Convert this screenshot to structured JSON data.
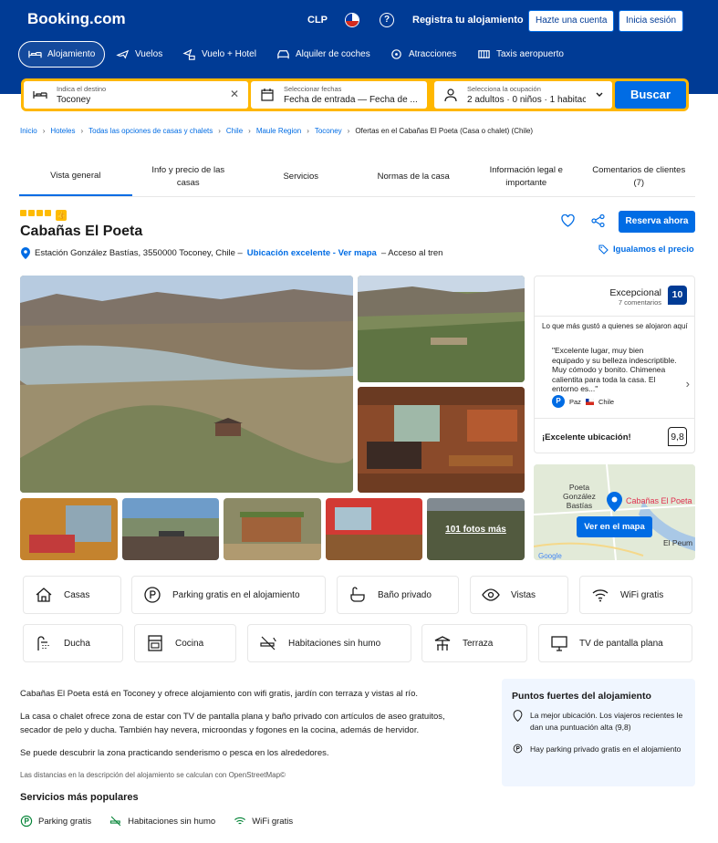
{
  "header": {
    "logo": "Booking.com",
    "currency": "CLP",
    "help": "?",
    "register": "Registra tu alojamiento",
    "signup": "Hazte una cuenta",
    "signin": "Inicia sesión"
  },
  "nav": [
    {
      "label": "Alojamiento",
      "icon": "bed-icon"
    },
    {
      "label": "Vuelos",
      "icon": "plane-icon"
    },
    {
      "label": "Vuelo + Hotel",
      "icon": "plane-hotel-icon"
    },
    {
      "label": "Alquiler de coches",
      "icon": "car-icon"
    },
    {
      "label": "Atracciones",
      "icon": "attractions-icon"
    },
    {
      "label": "Taxis aeropuerto",
      "icon": "taxi-icon"
    }
  ],
  "search": {
    "dest_label": "Indica el destino",
    "dest_value": "Toconey",
    "dates_label": "Seleccionar fechas",
    "dates_value": "Fecha de entrada — Fecha de ...",
    "occ_label": "Selecciona la ocupación",
    "occ_value": "2 adultos · 0 niños · 1 habitac",
    "button": "Buscar"
  },
  "breadcrumb": [
    "Inicio",
    "Hoteles",
    "Todas las opciones de casas y chalets",
    "Chile",
    "Maule Region",
    "Toconey",
    "Ofertas en el Cabañas El Poeta (Casa o chalet) (Chile)"
  ],
  "tabs": [
    "Vista general",
    "Info y precio de las casas",
    "Servicios",
    "Normas de la casa",
    "Información legal e importante",
    "Comentarios de clientes (7)"
  ],
  "property": {
    "name": "Cabañas El Poeta",
    "address": "Estación González Bastías, 3550000 Toconey, Chile –",
    "location_link": "Ubicación excelente - Ver mapa",
    "address_suffix": "– Acceso al tren",
    "reserve": "Reserva ahora",
    "price_match": "Igualamos el precio"
  },
  "gallery": {
    "more": "101 fotos más"
  },
  "review": {
    "label": "Excepcional",
    "count": "7 comentarios",
    "score": "10",
    "liked": "Lo que más gustó a quienes se alojaron aquí",
    "quote": "\"Excelente lugar, muy bien equipado y su belleza indescriptible. Muy cómodo y bonito. Chimenea calientita para toda la casa. El entorno es...\"",
    "author": "Paz",
    "author_initial": "P",
    "country": "Chile",
    "location_label": "¡Excelente ubicación!",
    "location_score": "9,8"
  },
  "map": {
    "place1": "Poeta",
    "place2": "González",
    "place3": "Bastías",
    "pin_label": "Cabañas El Poeta",
    "button": "Ver en el mapa",
    "google": "Google",
    "peum": "El Peum"
  },
  "facilities_row1": [
    {
      "label": "Casas",
      "icon": "house-icon"
    },
    {
      "label": "Parking gratis en el alojamiento",
      "icon": "parking-icon"
    },
    {
      "label": "Baño privado",
      "icon": "bath-icon"
    },
    {
      "label": "Vistas",
      "icon": "eye-icon"
    },
    {
      "label": "WiFi gratis",
      "icon": "wifi-icon"
    }
  ],
  "facilities_row2": [
    {
      "label": "Ducha",
      "icon": "shower-icon"
    },
    {
      "label": "Cocina",
      "icon": "kitchen-icon"
    },
    {
      "label": "Habitaciones sin humo",
      "icon": "no-smoking-icon"
    },
    {
      "label": "Terraza",
      "icon": "terrace-icon"
    },
    {
      "label": "TV de pantalla plana",
      "icon": "tv-icon"
    }
  ],
  "description": [
    "Cabañas El Poeta está en Toconey y ofrece alojamiento con wifi gratis, jardín con terraza y vistas al río.",
    "La casa o chalet ofrece zona de estar con TV de pantalla plana y baño privado con artículos de aseo gratuitos, secador de pelo y ducha. También hay nevera, microondas y fogones en la cocina, además de hervidor.",
    "Se puede descubrir la zona practicando senderismo o pesca en los alrededores."
  ],
  "distance_note": "Las distancias en la descripción del alojamiento se calculan con OpenStreetMap©",
  "popular": {
    "title": "Servicios más populares",
    "items": [
      "Parking gratis",
      "Habitaciones sin humo",
      "WiFi gratis"
    ]
  },
  "highlights": {
    "title": "Puntos fuertes del alojamiento",
    "items": [
      "La mejor ubicación. Los viajeros recientes le dan una puntuación alta (9,8)",
      "Hay parking privado gratis en el alojamiento"
    ]
  },
  "colors": {
    "brand": "#003b95",
    "accent": "#006ce4",
    "search_border": "#ffb700"
  }
}
